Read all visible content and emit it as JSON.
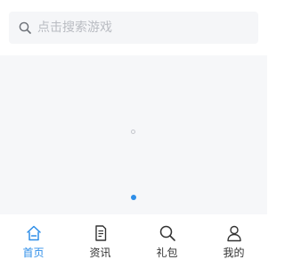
{
  "search": {
    "placeholder": "点击搜索游戏",
    "icon": "search-icon"
  },
  "banner": {
    "state": "loading",
    "page_count": 1,
    "active_page": 1
  },
  "tabbar": {
    "active_color": "#2e8ee8",
    "inactive_color": "#333333",
    "tabs": [
      {
        "label": "首页",
        "icon": "home-icon",
        "active": true
      },
      {
        "label": "资讯",
        "icon": "document-icon",
        "active": false
      },
      {
        "label": "礼包",
        "icon": "search-icon",
        "active": false
      },
      {
        "label": "我的",
        "icon": "user-icon",
        "active": false
      }
    ]
  }
}
